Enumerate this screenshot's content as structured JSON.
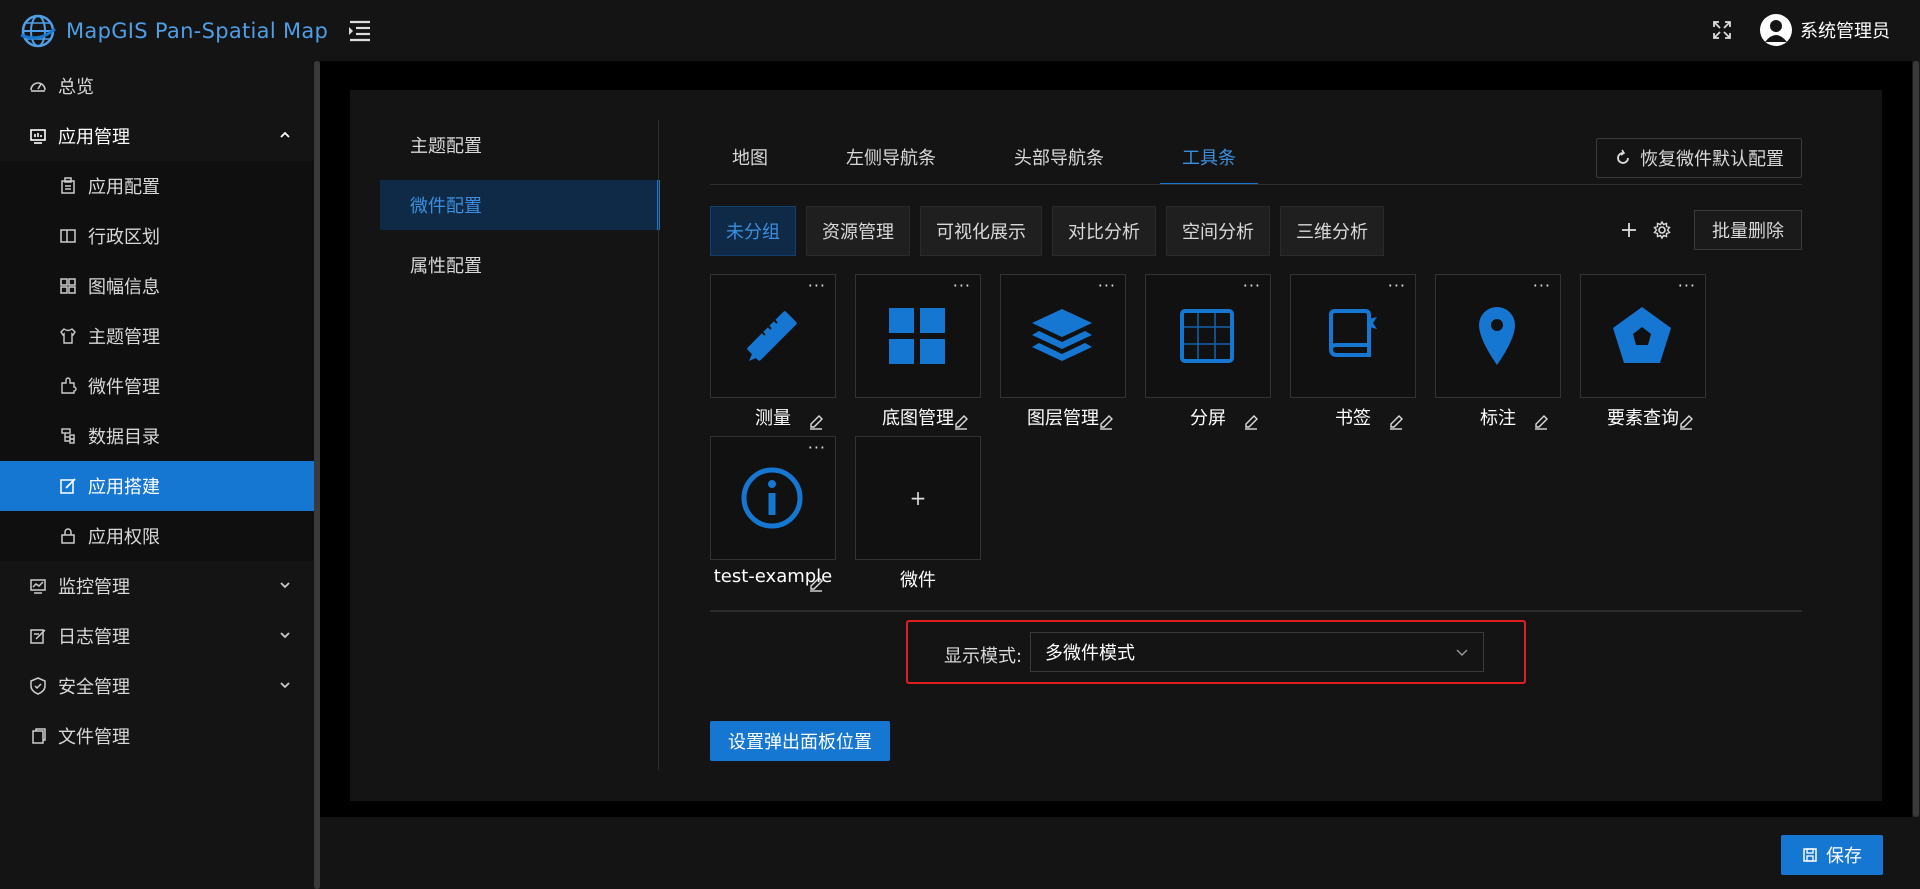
{
  "app": {
    "title": "MapGIS Pan-Spatial Map"
  },
  "header": {
    "user_name": "系统管理员"
  },
  "sidebar": {
    "items": [
      {
        "label": "总览",
        "icon": "dashboard-icon"
      },
      {
        "label": "应用管理",
        "icon": "app-manage-icon",
        "expanded": true
      },
      {
        "label": "应用配置",
        "icon": "app-config-icon"
      },
      {
        "label": "行政区划",
        "icon": "region-icon"
      },
      {
        "label": "图幅信息",
        "icon": "grid-icon"
      },
      {
        "label": "主题管理",
        "icon": "theme-icon"
      },
      {
        "label": "微件管理",
        "icon": "widget-icon"
      },
      {
        "label": "数据目录",
        "icon": "catalog-icon"
      },
      {
        "label": "应用搭建",
        "icon": "build-icon",
        "active": true
      },
      {
        "label": "应用权限",
        "icon": "lock-icon"
      },
      {
        "label": "监控管理",
        "icon": "monitor-icon"
      },
      {
        "label": "日志管理",
        "icon": "log-icon"
      },
      {
        "label": "安全管理",
        "icon": "shield-icon"
      },
      {
        "label": "文件管理",
        "icon": "file-icon"
      }
    ]
  },
  "config_tabs": [
    "主题配置",
    "微件配置",
    "属性配置"
  ],
  "top_tabs": [
    "地图",
    "左侧导航条",
    "头部导航条",
    "工具条"
  ],
  "restore_button": "恢复微件默认配置",
  "groups": [
    "未分组",
    "资源管理",
    "可视化展示",
    "对比分析",
    "空间分析",
    "三维分析"
  ],
  "batch_delete": "批量删除",
  "widgets": [
    {
      "label": "测量",
      "icon": "measure-icon"
    },
    {
      "label": "底图管理",
      "icon": "basemap-icon"
    },
    {
      "label": "图层管理",
      "icon": "layers-icon"
    },
    {
      "label": "分屏",
      "icon": "split-screen-icon"
    },
    {
      "label": "书签",
      "icon": "bookmark-icon"
    },
    {
      "label": "标注",
      "icon": "marker-icon"
    },
    {
      "label": "要素查询",
      "icon": "feature-query-icon"
    },
    {
      "label": "test-example",
      "icon": "info-icon"
    }
  ],
  "add_widget": {
    "symbol": "+",
    "label": "微件"
  },
  "more_symbol": "···",
  "display_mode": {
    "label": "显示模式:",
    "value": "多微件模式"
  },
  "popup_button": "设置弹出面板位置",
  "save_button": "保存",
  "colors": {
    "accent": "#1677d2",
    "highlight_border": "#e02020"
  }
}
